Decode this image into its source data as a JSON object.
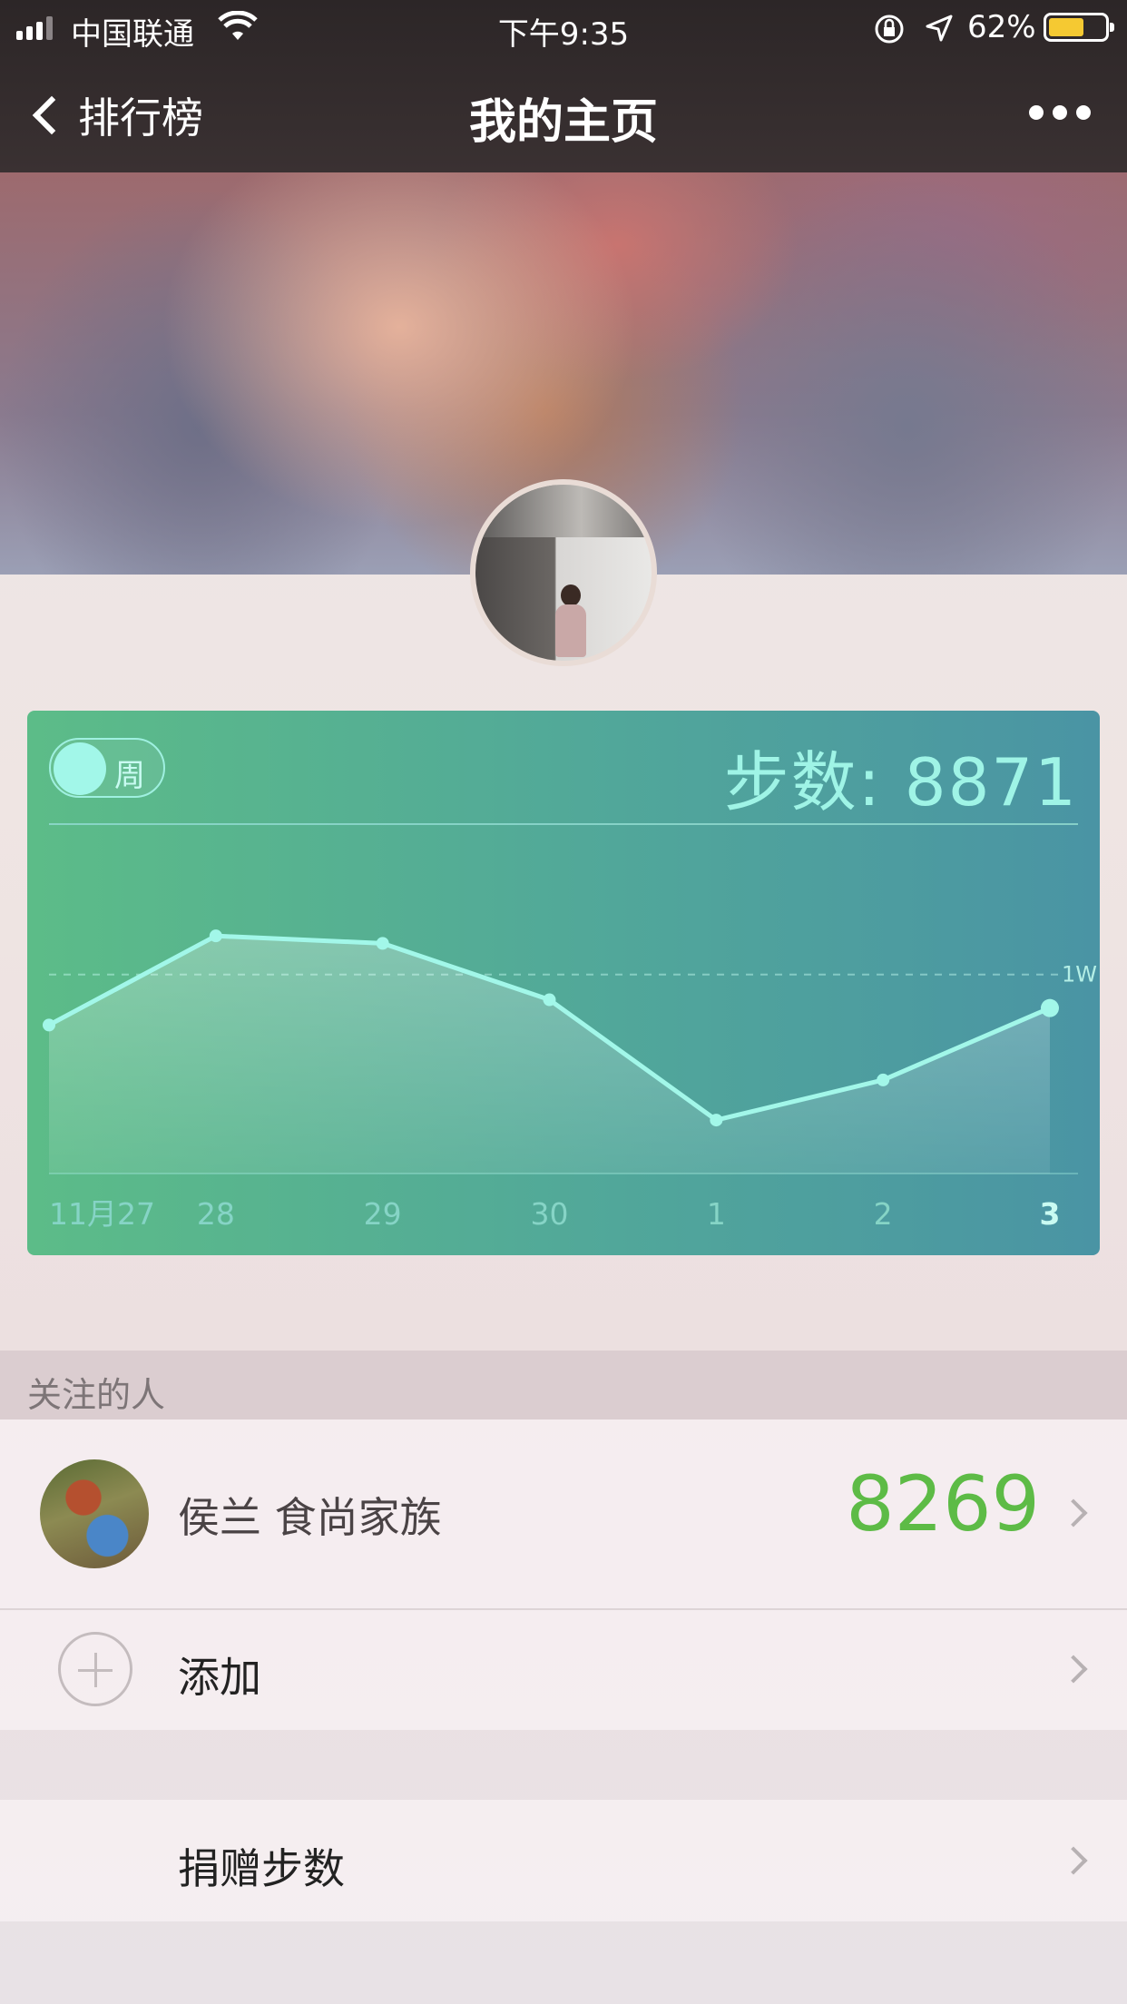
{
  "status_bar": {
    "carrier": "中国联通",
    "time": "下午9:35",
    "battery_percent": "62%",
    "battery_level": 0.62,
    "battery_color": "#f5c932"
  },
  "nav": {
    "back_label": "排行榜",
    "title": "我的主页",
    "more_icon": "more-dots-icon"
  },
  "steps_card": {
    "toggle_label": "周",
    "steps_text": "步数: 8871",
    "reference_label": "1W"
  },
  "chart_data": {
    "type": "area",
    "categories": [
      "11月27",
      "28",
      "29",
      "30",
      "1",
      "2",
      "3"
    ],
    "values": [
      8300,
      11300,
      11050,
      9150,
      5100,
      6450,
      8871
    ],
    "reference_line": 10000,
    "ylim": [
      3300,
      14300
    ],
    "grid": false,
    "highlight_index": 6
  },
  "following": {
    "section_title": "关注的人",
    "friends": [
      {
        "name": "侯兰  食尚家族",
        "steps": "8269"
      }
    ],
    "add_label": "添加"
  },
  "donate": {
    "label": "捐赠步数"
  },
  "colors": {
    "accent_green": "#5dbb46",
    "chart_line": "#a2f7e9"
  }
}
